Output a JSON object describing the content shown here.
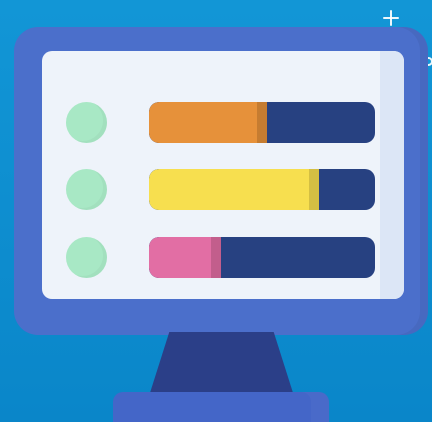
{
  "illustration": {
    "icons": {
      "plus": "plus-sparkle-icon",
      "circle": "circle-sparkle-icon"
    },
    "colors": {
      "background": "#1296d6",
      "monitor_frame": "#4b6fcb",
      "screen": "#eef3fa",
      "dot": "#a8e8c5",
      "track": "#274181",
      "stand": "#2b3f88"
    },
    "bars": [
      {
        "fill_percent": 52,
        "color": "#e6913a"
      },
      {
        "fill_percent": 75,
        "color": "#f7df4f"
      },
      {
        "fill_percent": 32,
        "color": "#e26ea4"
      }
    ]
  }
}
